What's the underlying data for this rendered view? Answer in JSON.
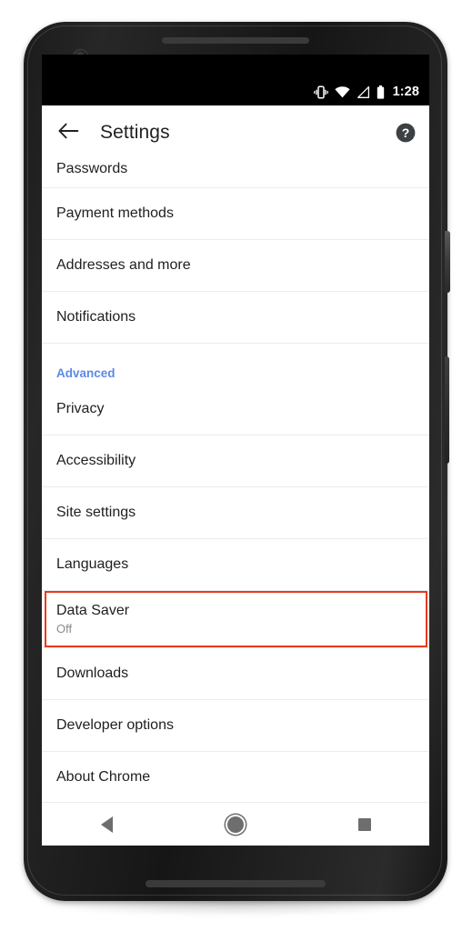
{
  "device": {
    "name": "pixel-phone",
    "hardware": {
      "power_button": "power-button",
      "volume_button": "volume-rocker",
      "earpiece": "earpiece-speaker",
      "bottom_speaker": "bottom-speaker",
      "front_camera": "front-camera"
    }
  },
  "statusbar": {
    "time": "1:28",
    "icons": [
      "vibrate-icon",
      "wifi-icon",
      "signal-icon",
      "battery-icon"
    ]
  },
  "toolbar": {
    "back_icon": "back-arrow-icon",
    "title": "Settings",
    "help_icon": "help-circle-icon"
  },
  "list": {
    "partial_top_item": {
      "title": "Passwords"
    },
    "items": [
      {
        "title": "Payment methods"
      },
      {
        "title": "Addresses and more"
      },
      {
        "title": "Notifications"
      }
    ],
    "section": {
      "label": "Advanced"
    },
    "advanced_items": [
      {
        "title": "Privacy"
      },
      {
        "title": "Accessibility"
      },
      {
        "title": "Site settings"
      },
      {
        "title": "Languages"
      }
    ],
    "highlighted_item": {
      "title": "Data Saver",
      "subtitle": "Off",
      "highlight_color": "#e8391c"
    },
    "trailing_items": [
      {
        "title": "Downloads"
      },
      {
        "title": "Developer options"
      },
      {
        "title": "About Chrome"
      }
    ]
  },
  "navbar": {
    "back": "nav-back-icon",
    "home": "nav-home-icon",
    "recents": "nav-recents-icon"
  },
  "colors": {
    "accent_blue": "#5c8ae6",
    "highlight_red": "#e8391c",
    "text_primary": "#1f1f1f",
    "text_secondary": "#8a8a8a"
  }
}
